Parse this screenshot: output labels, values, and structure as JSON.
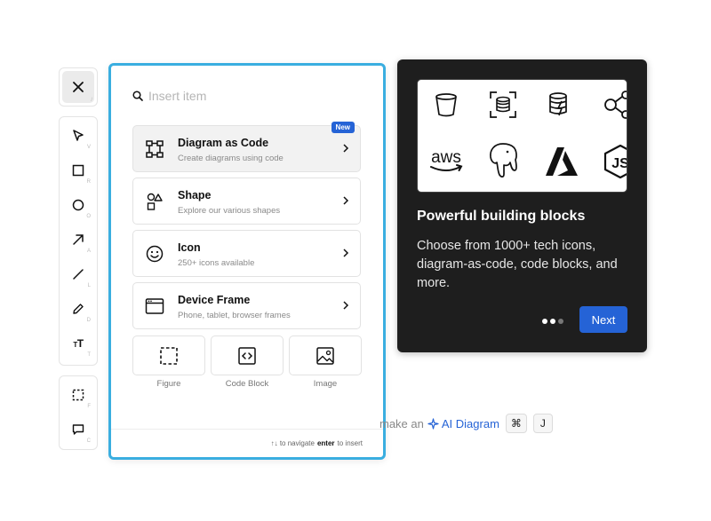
{
  "toolbar": {
    "close_key": "/",
    "tools": [
      {
        "name": "select",
        "key": "V"
      },
      {
        "name": "rectangle",
        "key": "R"
      },
      {
        "name": "ellipse",
        "key": "O"
      },
      {
        "name": "arrow",
        "key": "A"
      },
      {
        "name": "line",
        "key": "L"
      },
      {
        "name": "pencil",
        "key": "D"
      },
      {
        "name": "text",
        "key": "T",
        "glyph": "T",
        "glyph_small": "T"
      }
    ],
    "lower_tools": [
      {
        "name": "frame",
        "key": "F"
      },
      {
        "name": "comment",
        "key": "C"
      }
    ]
  },
  "insert_panel": {
    "search_placeholder": "Insert item",
    "items": [
      {
        "title": "Diagram as Code",
        "subtitle": "Create diagrams using code",
        "badge": "New",
        "icon": "diagram-icon"
      },
      {
        "title": "Shape",
        "subtitle": "Explore our various shapes",
        "icon": "shapes-icon"
      },
      {
        "title": "Icon",
        "subtitle": "250+ icons available",
        "icon": "smiley-icon"
      },
      {
        "title": "Device Frame",
        "subtitle": "Phone, tablet, browser frames",
        "icon": "browser-window-icon"
      }
    ],
    "tiles": [
      {
        "label": "Figure",
        "icon": "dashed-square-icon"
      },
      {
        "label": "Code Block",
        "icon": "code-icon"
      },
      {
        "label": "Image",
        "icon": "image-icon"
      }
    ],
    "footer": {
      "arrows": "↑↓",
      "navigate_text": "to navigate",
      "enter_key": "enter",
      "insert_text": "to insert"
    }
  },
  "onboarding_card": {
    "title": "Powerful building blocks",
    "body": "Choose from 1000+ tech icons, diagram-as-code, code blocks, and more.",
    "next_label": "Next",
    "dots_total": 3,
    "dots_active": 1,
    "preview_icons": [
      "bucket-icon",
      "database-scan-icon",
      "stacked-db-icon",
      "share-nodes-icon",
      "aws-logo-icon",
      "elephant-icon",
      "azure-logo-icon",
      "nodejs-logo-icon"
    ],
    "aws_text": "aws",
    "js_text": "JS"
  },
  "hint": {
    "prefix": "make an",
    "ai_label": "AI Diagram",
    "key1": "⌘",
    "key2": "J"
  },
  "colors": {
    "accent": "#2563d6",
    "panel_border": "#3aaee0",
    "card_bg": "#1e1e1e"
  }
}
